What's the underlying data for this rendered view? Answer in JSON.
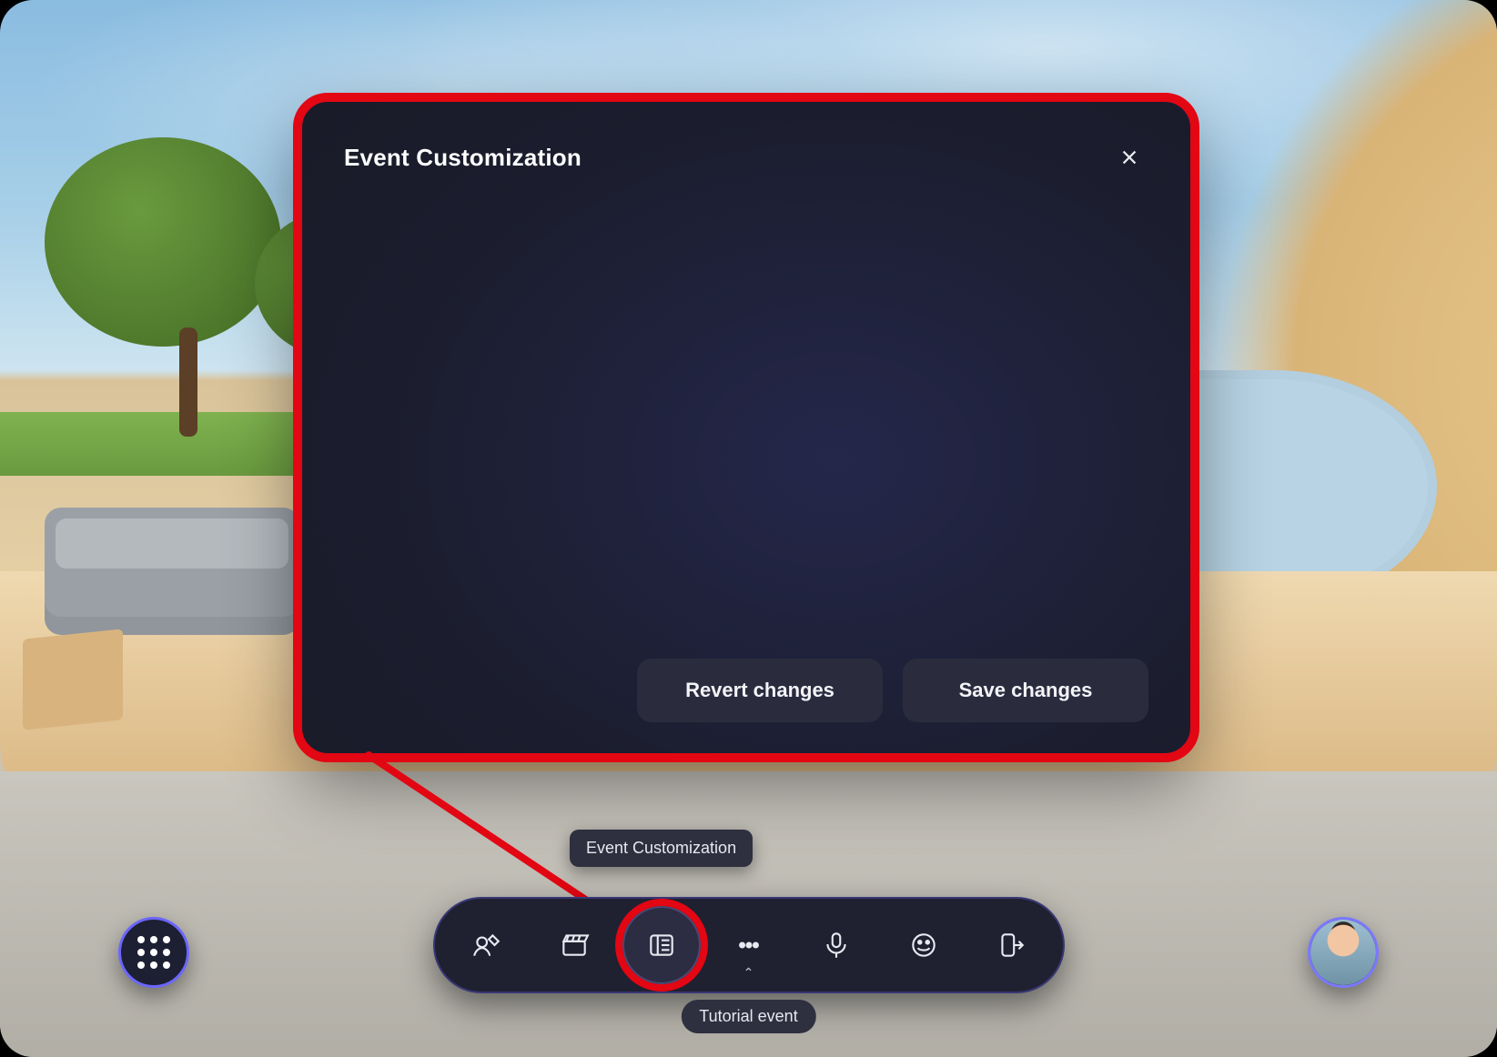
{
  "modal": {
    "title": "Event Customization",
    "revert_label": "Revert changes",
    "save_label": "Save changes"
  },
  "tooltip": {
    "text": "Event Customization"
  },
  "event_label": "Tutorial event",
  "toolbar": {
    "items": [
      {
        "icon": "customize-avatar-icon"
      },
      {
        "icon": "clapperboard-icon"
      },
      {
        "icon": "event-customization-icon",
        "selected": true,
        "highlighted": true
      },
      {
        "icon": "more-icon",
        "has_chevron": true
      },
      {
        "icon": "microphone-icon"
      },
      {
        "icon": "emoji-icon"
      },
      {
        "icon": "leave-icon"
      }
    ]
  },
  "corner": {
    "menu_name": "app-menu-button",
    "avatar_name": "profile-avatar-button"
  },
  "colors": {
    "accent": "#6b66ff",
    "highlight": "#e30613",
    "panel": "#1f2030"
  }
}
